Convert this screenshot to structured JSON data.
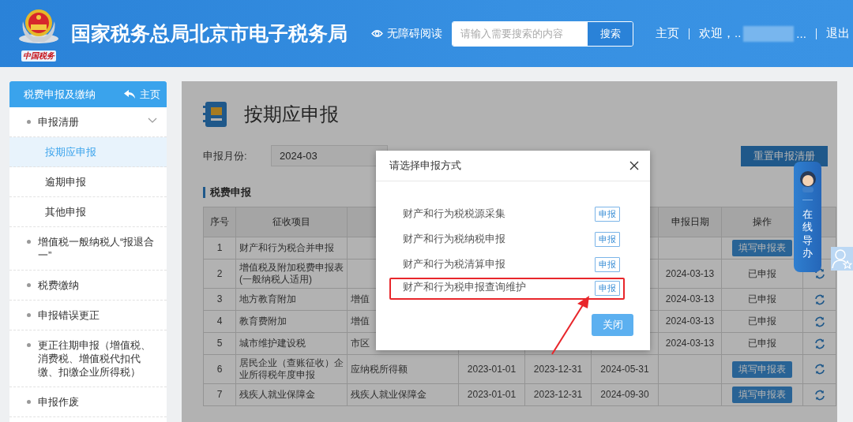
{
  "header": {
    "logo_caption": "中国税务",
    "title": "国家税务总局北京市电子税务局",
    "accessibility": "无障碍阅读",
    "search": {
      "placeholder": "请输入需要搜索的内容",
      "button": "搜索"
    },
    "nav": [
      {
        "kind": "link",
        "label": "主页"
      },
      {
        "kind": "text",
        "label": "欢迎，.."
      },
      {
        "kind": "redacted"
      },
      {
        "kind": "text",
        "label": "..."
      },
      {
        "kind": "link",
        "label": "退出"
      }
    ]
  },
  "sidebar": {
    "title": "税费申报及缴纳",
    "home": "主页",
    "items": [
      {
        "label": "申报清册",
        "expanded": true,
        "selected": false,
        "children": [
          {
            "label": "按期应申报",
            "selected": true
          },
          {
            "label": "逾期申报",
            "selected": false
          },
          {
            "label": "其他申报",
            "selected": false
          }
        ]
      },
      {
        "label": "增值税一般纳税人“报退合一”",
        "selected": false
      },
      {
        "label": "税费缴纳",
        "selected": false
      },
      {
        "label": "申报错误更正",
        "selected": false
      },
      {
        "label": "更正往期申报（增值税、消费税、增值税代扣代缴、扣缴企业所得税）",
        "selected": false
      },
      {
        "label": "申报作废",
        "selected": false
      }
    ]
  },
  "main": {
    "title": "按期应申报",
    "month_label": "申报月份:",
    "month_value": "2024-03",
    "reset_button": "重置申报清册",
    "section": "税费申报",
    "table": {
      "columns": [
        {
          "label": "序号"
        },
        {
          "label": "征收项目"
        },
        {},
        {},
        {},
        {},
        {
          "label": "申报日期"
        },
        {
          "label": "操作"
        },
        {}
      ],
      "rows": [
        {
          "cells": [
            "1",
            "财产和行为税合并申报",
            null,
            null,
            null,
            null,
            null,
            {
              "kind": "button",
              "label": "填写申报表"
            },
            null
          ]
        },
        {
          "cells": [
            "2",
            "增值税及附加税费申报表(一般纳税人适用)",
            null,
            null,
            null,
            null,
            "2024-03-13",
            {
              "kind": "text",
              "label": "已申报"
            },
            {
              "kind": "refresh"
            }
          ]
        },
        {
          "cells": [
            "3",
            "地方教育附加",
            "增值",
            null,
            null,
            null,
            "2024-03-13",
            {
              "kind": "text",
              "label": "已申报"
            },
            {
              "kind": "refresh"
            }
          ]
        },
        {
          "cells": [
            "4",
            "教育费附加",
            "增值",
            null,
            null,
            null,
            "2024-03-13",
            {
              "kind": "text",
              "label": "已申报"
            },
            {
              "kind": "refresh"
            }
          ]
        },
        {
          "cells": [
            "5",
            "城市维护建设税",
            "市区",
            null,
            null,
            null,
            "2024-03-13",
            {
              "kind": "text",
              "label": "已申报"
            },
            {
              "kind": "refresh"
            }
          ]
        },
        {
          "cells": [
            "6",
            "居民企业（查账征收）企业所得税年度申报",
            "应纳税所得额",
            "2023-01-01",
            "2023-12-31",
            "2024-05-31",
            null,
            {
              "kind": "button",
              "label": "填写申报表"
            },
            {
              "kind": "refresh"
            }
          ]
        },
        {
          "cells": [
            "7",
            "残疾人就业保障金",
            "残疾人就业保障金",
            "2023-01-01",
            "2023-12-31",
            "2024-09-30",
            null,
            {
              "kind": "button",
              "label": "填写申报表"
            },
            {
              "kind": "refresh"
            }
          ]
        }
      ]
    }
  },
  "modal": {
    "title": "请选择申报方式",
    "options": [
      {
        "label": "财产和行为税税源采集",
        "button": "申报",
        "highlighted": false
      },
      {
        "label": "财产和行为税纳税申报",
        "button": "申报",
        "highlighted": false
      },
      {
        "label": "财产和行为税清算申报",
        "button": "申报",
        "highlighted": false
      },
      {
        "label": "财产和行为税申报查询维护",
        "button": "申报",
        "highlighted": true
      }
    ],
    "close_button": "关闭"
  },
  "guide": {
    "label": "在线导办"
  }
}
